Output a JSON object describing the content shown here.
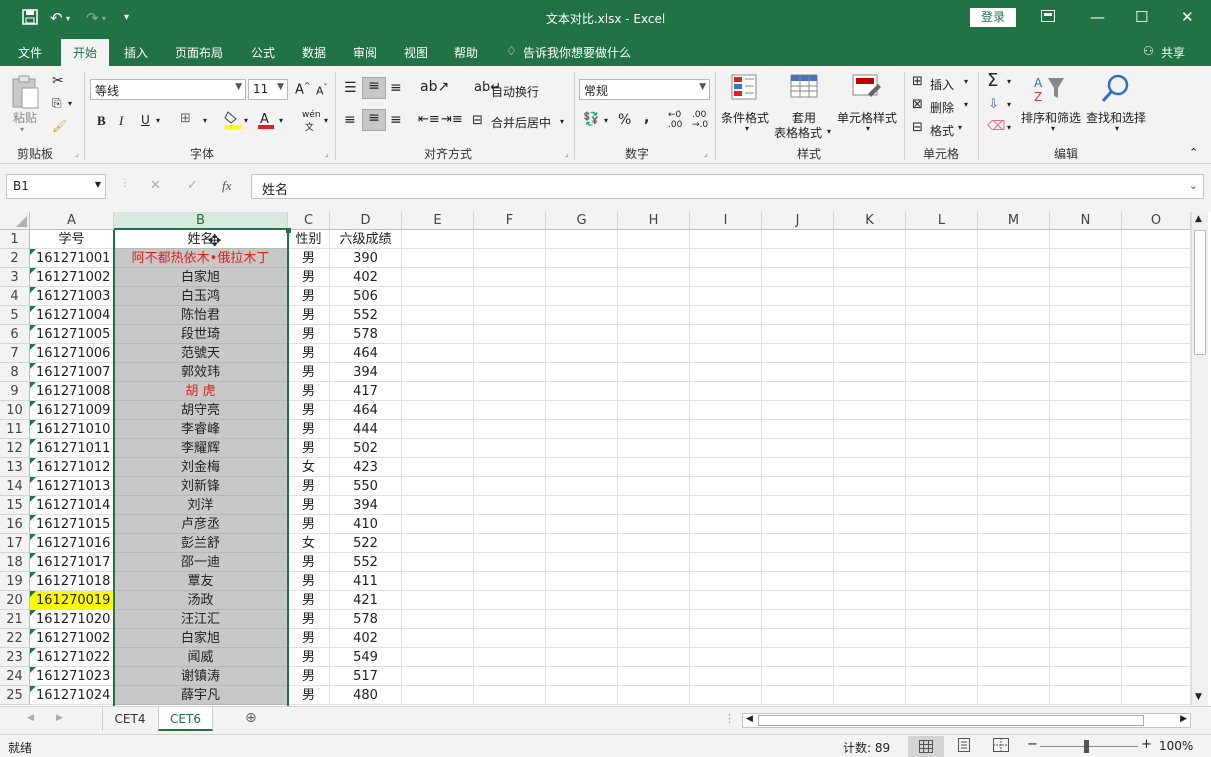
{
  "window": {
    "title": "文本对比.xlsx  -  Excel",
    "login_label": "登录",
    "share_label": "共享"
  },
  "tabs": [
    "文件",
    "开始",
    "插入",
    "页面布局",
    "公式",
    "数据",
    "审阅",
    "视图",
    "帮助"
  ],
  "tell_me": "告诉我你想要做什么",
  "ribbon": {
    "paste": "粘贴",
    "font_name": "等线",
    "font_size": "11",
    "wrap_text": "自动换行",
    "merge_center": "合并后居中",
    "number_format": "常规",
    "cond_format": "条件格式",
    "table_format_1": "套用",
    "table_format_2": "表格格式",
    "cell_styles": "单元格样式",
    "insert": "插入",
    "delete": "删除",
    "format": "格式",
    "sort_filter": "排序和筛选",
    "find_select": "查找和选择",
    "groups": [
      "剪贴板",
      "字体",
      "对齐方式",
      "数字",
      "样式",
      "单元格",
      "编辑"
    ]
  },
  "formula_bar": {
    "name_box": "B1",
    "formula": "姓名"
  },
  "columns": [
    "A",
    "B",
    "C",
    "D",
    "E",
    "F",
    "G",
    "H",
    "I",
    "J",
    "K",
    "L",
    "M",
    "N",
    "O"
  ],
  "row_numbers": [
    "1",
    "2",
    "3",
    "4",
    "5",
    "6",
    "7",
    "8",
    "9",
    "10",
    "11",
    "12",
    "13",
    "14",
    "15",
    "16",
    "17",
    "18",
    "19",
    "20",
    "21",
    "22",
    "23",
    "24",
    "25"
  ],
  "rows": [
    {
      "a": "学号",
      "b": "姓名",
      "c": "性别",
      "d": "六级成绩"
    },
    {
      "a": "161271001",
      "b": "阿不都热依木•俄拉木丁",
      "c": "男",
      "d": "390"
    },
    {
      "a": "161271002",
      "b": "白家旭",
      "c": "男",
      "d": "402"
    },
    {
      "a": "161271003",
      "b": "白玉鸿",
      "c": "男",
      "d": "506"
    },
    {
      "a": "161271004",
      "b": "陈怡君",
      "c": "男",
      "d": "552"
    },
    {
      "a": "161271005",
      "b": "段世琦",
      "c": "男",
      "d": "578"
    },
    {
      "a": "161271006",
      "b": "范號天",
      "c": "男",
      "d": "464"
    },
    {
      "a": "161271007",
      "b": "郭效玮",
      "c": "男",
      "d": "394"
    },
    {
      "a": "161271008",
      "b": "胡 虎",
      "c": "男",
      "d": "417"
    },
    {
      "a": "161271009",
      "b": "胡守亮",
      "c": "男",
      "d": "464"
    },
    {
      "a": "161271010",
      "b": "李睿峰",
      "c": "男",
      "d": "444"
    },
    {
      "a": "161271011",
      "b": "李耀辉",
      "c": "男",
      "d": "502"
    },
    {
      "a": "161271012",
      "b": "刘金梅",
      "c": "女",
      "d": "423"
    },
    {
      "a": "161271013",
      "b": "刘新锋",
      "c": "男",
      "d": "550"
    },
    {
      "a": "161271014",
      "b": "刘洋",
      "c": "男",
      "d": "394"
    },
    {
      "a": "161271015",
      "b": "卢彦丞",
      "c": "男",
      "d": "410"
    },
    {
      "a": "161271016",
      "b": "彭兰舒",
      "c": "女",
      "d": "522"
    },
    {
      "a": "161271017",
      "b": "邵一迪",
      "c": "男",
      "d": "552"
    },
    {
      "a": "161271018",
      "b": "覃友",
      "c": "男",
      "d": "411"
    },
    {
      "a": "161270019",
      "b": "汤政",
      "c": "男",
      "d": "421"
    },
    {
      "a": "161271020",
      "b": "汪江汇",
      "c": "男",
      "d": "578"
    },
    {
      "a": "161271002",
      "b": "白家旭",
      "c": "男",
      "d": "402"
    },
    {
      "a": "161271022",
      "b": "闻威",
      "c": "男",
      "d": "549"
    },
    {
      "a": "161271023",
      "b": "谢镇涛",
      "c": "男",
      "d": "517"
    },
    {
      "a": "161271024",
      "b": "薛宇凡",
      "c": "男",
      "d": "480"
    }
  ],
  "sheets": [
    "CET4",
    "CET6"
  ],
  "status": {
    "ready": "就绪",
    "count": "计数: 89",
    "zoom": "100%"
  },
  "colors": {
    "brand": "#217346",
    "highlight": "#ffff00",
    "red_text": "#e0201e",
    "selected_fill": "#c8c8c8"
  }
}
